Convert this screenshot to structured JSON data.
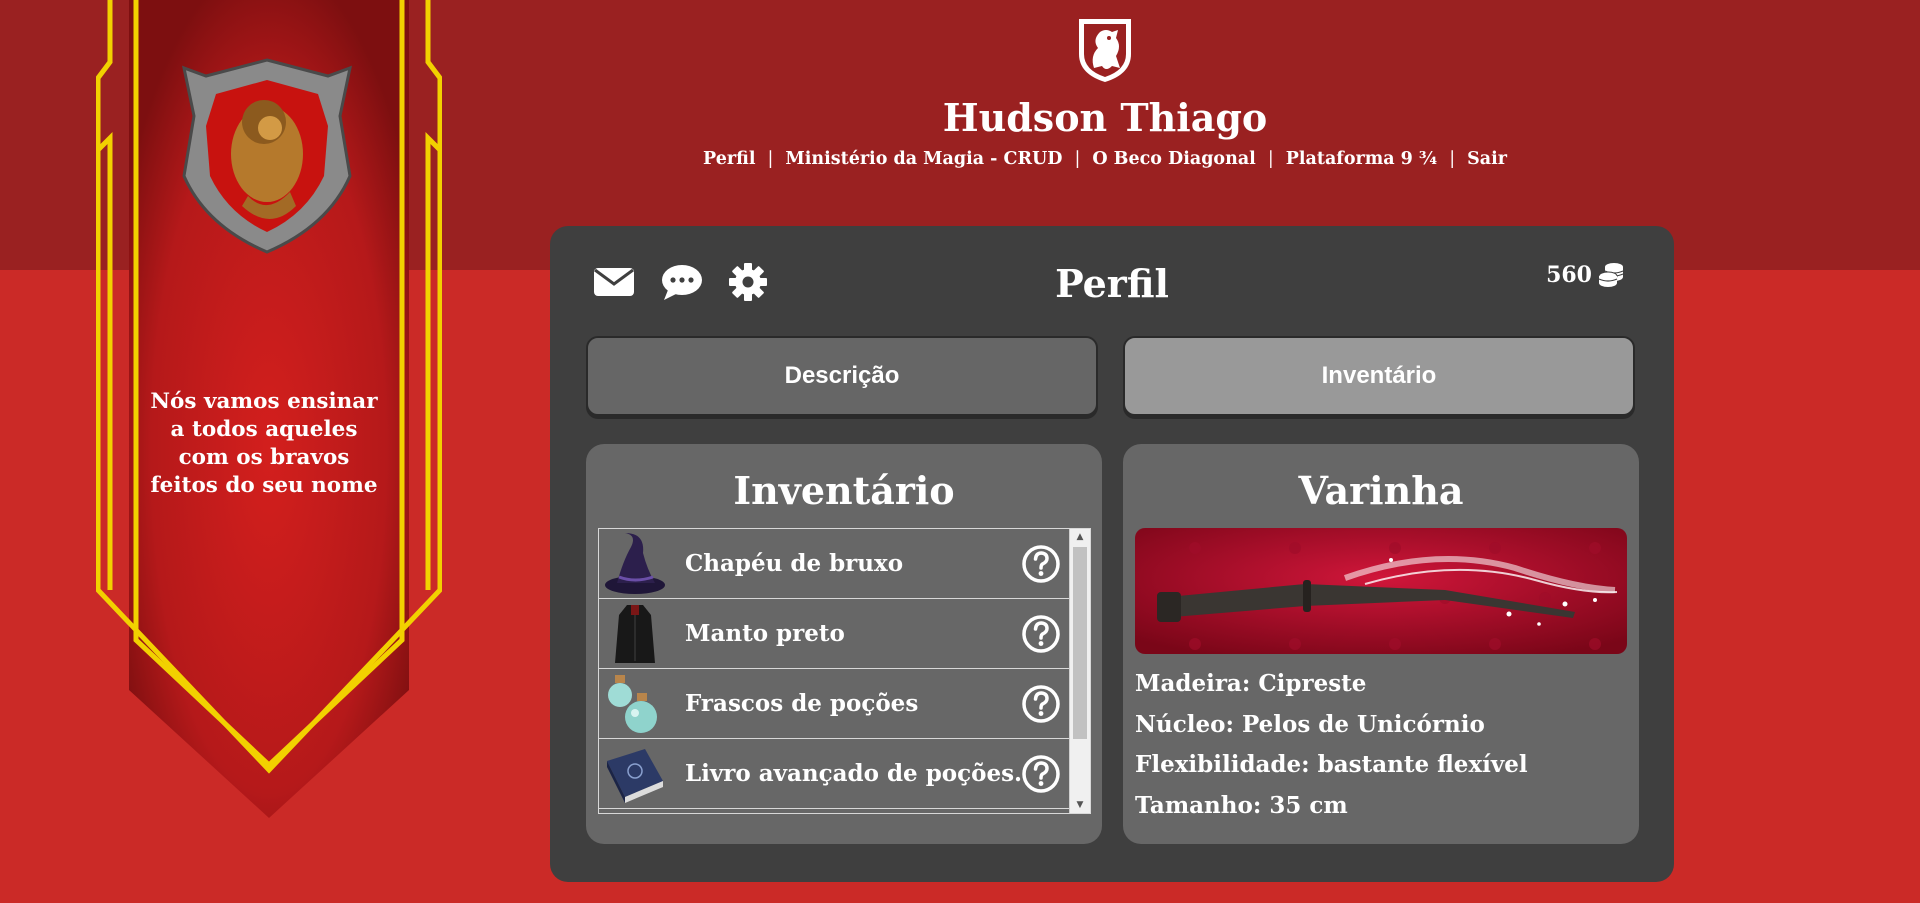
{
  "header": {
    "user_name": "Hudson Thiago",
    "nav": [
      "Perfil",
      "Ministério da Magia - CRUD",
      "O Beco Diagonal",
      "Plataforma 9 ¾",
      "Sair"
    ],
    "nav_separator": "|"
  },
  "banner": {
    "motto": "Nós vamos ensinar a todos aqueles com os bravos feitos do seu nome",
    "colors": {
      "banner": "#c11c1a",
      "trim": "#f2d100"
    }
  },
  "panel": {
    "title": "Perfil",
    "coins": "560",
    "icons": [
      "envelope-icon",
      "chat-icon",
      "gear-icon",
      "coins-icon"
    ],
    "tabs": [
      {
        "label": "Descrição",
        "active": false
      },
      {
        "label": "Inventário",
        "active": true
      }
    ]
  },
  "inventory": {
    "title": "Inventário",
    "items": [
      {
        "label": "Chapéu de bruxo",
        "icon": "wizard-hat-icon"
      },
      {
        "label": "Manto preto",
        "icon": "robe-icon"
      },
      {
        "label": "Frascos de poções",
        "icon": "potion-bottles-icon"
      },
      {
        "label": "Livro avançado de poções.",
        "icon": "book-icon"
      }
    ]
  },
  "wand": {
    "title": "Varinha",
    "properties": [
      "Madeira: Cipreste",
      "Núcleo: Pelos de Unicórnio",
      "Flexibilidade: bastante flexível",
      "Tamanho: 35 cm"
    ]
  },
  "colors": {
    "background": "#cb2a27",
    "header_band": "#9a2121",
    "panel": "#3f3f3f",
    "card": "#676767"
  }
}
